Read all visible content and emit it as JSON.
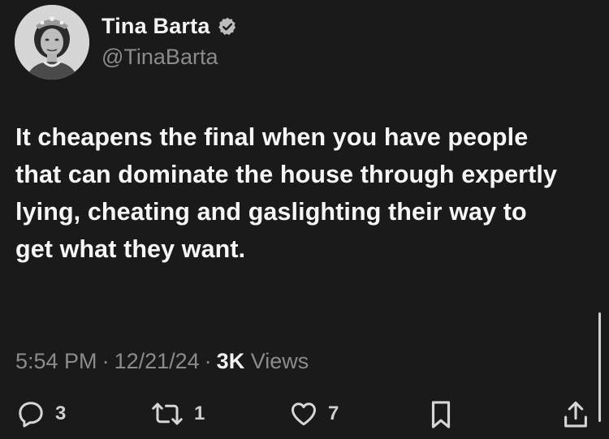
{
  "author": {
    "display_name": "Tina Barta",
    "handle": "@TinaBarta",
    "verified": true
  },
  "tweet": {
    "text": "It cheapens the final when you have people that can dominate the house through expertly lying, cheating and gaslighting their way to get what they want."
  },
  "meta": {
    "time": "5:54 PM",
    "separator": "·",
    "date": "12/21/24",
    "views_count": "3K",
    "views_label": "Views"
  },
  "actions": {
    "replies": "3",
    "reposts": "1",
    "likes": "7"
  },
  "icons": {
    "reply": "reply-icon",
    "repost": "repost-icon",
    "like": "heart-icon",
    "bookmark": "bookmark-icon",
    "share": "share-icon",
    "verified": "verified-badge-icon"
  },
  "colors": {
    "background": "#1a1a1a",
    "primary_text": "#f4f4f4",
    "secondary_text": "#8b8b8b"
  }
}
